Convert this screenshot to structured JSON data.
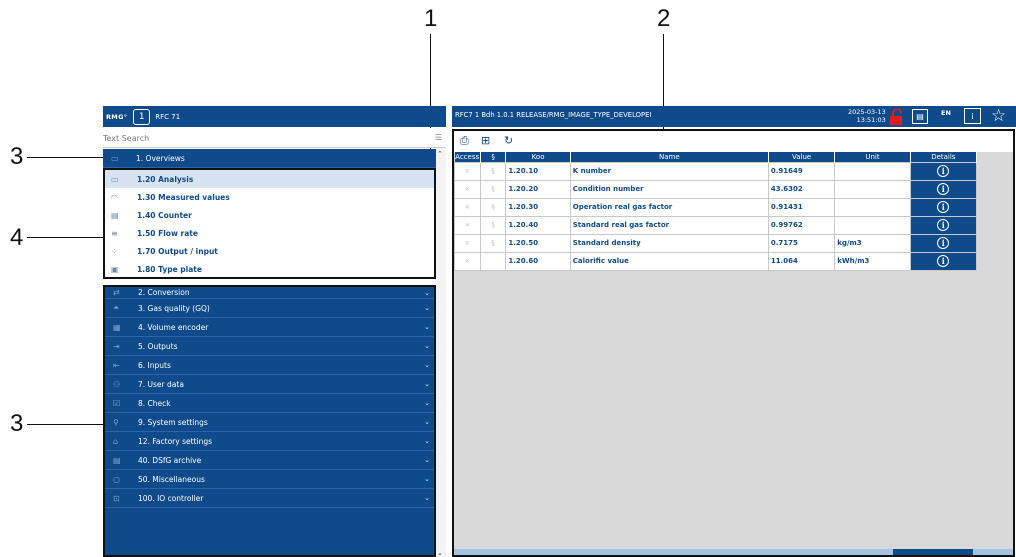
{
  "callouts": {
    "c1": "1",
    "c2": "2",
    "c3a": "3",
    "c3b": "3",
    "c4": "4"
  },
  "left_header": {
    "logo": "RMG°",
    "hex_label": "1",
    "device": "RFC 71"
  },
  "search": {
    "placeholder": "Text Search",
    "value": ""
  },
  "menu": {
    "overviews": "1. Overviews",
    "sub_items": [
      {
        "label": "1.20 Analysis",
        "icon": "analysis-icon",
        "active": true
      },
      {
        "label": "1.30 Measured values",
        "icon": "gauge-icon"
      },
      {
        "label": "1.40 Counter",
        "icon": "counter-icon"
      },
      {
        "label": "1.50 Flow rate",
        "icon": "flow-icon"
      },
      {
        "label": "1.70 Output / input",
        "icon": "io-icon"
      },
      {
        "label": "1.80 Type plate",
        "icon": "type-plate-icon"
      }
    ],
    "groups": [
      "2. Conversion",
      "3. Gas quality (GQ)",
      "4. Volume encoder",
      "5. Outputs",
      "6. Inputs",
      "7. User data",
      "8. Check",
      "9. System settings",
      "12. Factory settings",
      "40. DSfG archive",
      "50. Miscellaneous",
      "100. IO controller"
    ]
  },
  "right_header": {
    "info": "RFC7  1  Bdh  1.0.1 RELEASE/RMG_IMAGE_TYPE_DEVELOPEI",
    "date": "2025-03-13",
    "time": "13:51:03",
    "lang": "EN"
  },
  "table": {
    "columns": [
      "Access",
      "§",
      "Koo",
      "Name",
      "Value",
      "Unit",
      "Details"
    ],
    "rows": [
      {
        "access": "×",
        "sec": "§",
        "koo": "1.20.10",
        "name": "K number",
        "value": "0.91649",
        "unit": ""
      },
      {
        "access": "×",
        "sec": "§",
        "koo": "1.20.20",
        "name": "Condition number",
        "value": "43.6302",
        "unit": ""
      },
      {
        "access": "×",
        "sec": "§",
        "koo": "1.20.30",
        "name": "Operation real gas factor",
        "value": "0.91431",
        "unit": ""
      },
      {
        "access": "×",
        "sec": "§",
        "koo": "1.20.40",
        "name": "Standard real gas factor",
        "value": "0.99762",
        "unit": ""
      },
      {
        "access": "×",
        "sec": "§",
        "koo": "1.20.50",
        "name": "Standard density",
        "value": "0.7175",
        "unit": "kg/m3"
      },
      {
        "access": "×",
        "sec": "",
        "koo": "1.20.60",
        "name": "Calorific value",
        "value": "11.064",
        "unit": "kWh/m3"
      }
    ]
  },
  "colors": {
    "brand": "#0f4a8a",
    "lock": "#e31b23"
  }
}
